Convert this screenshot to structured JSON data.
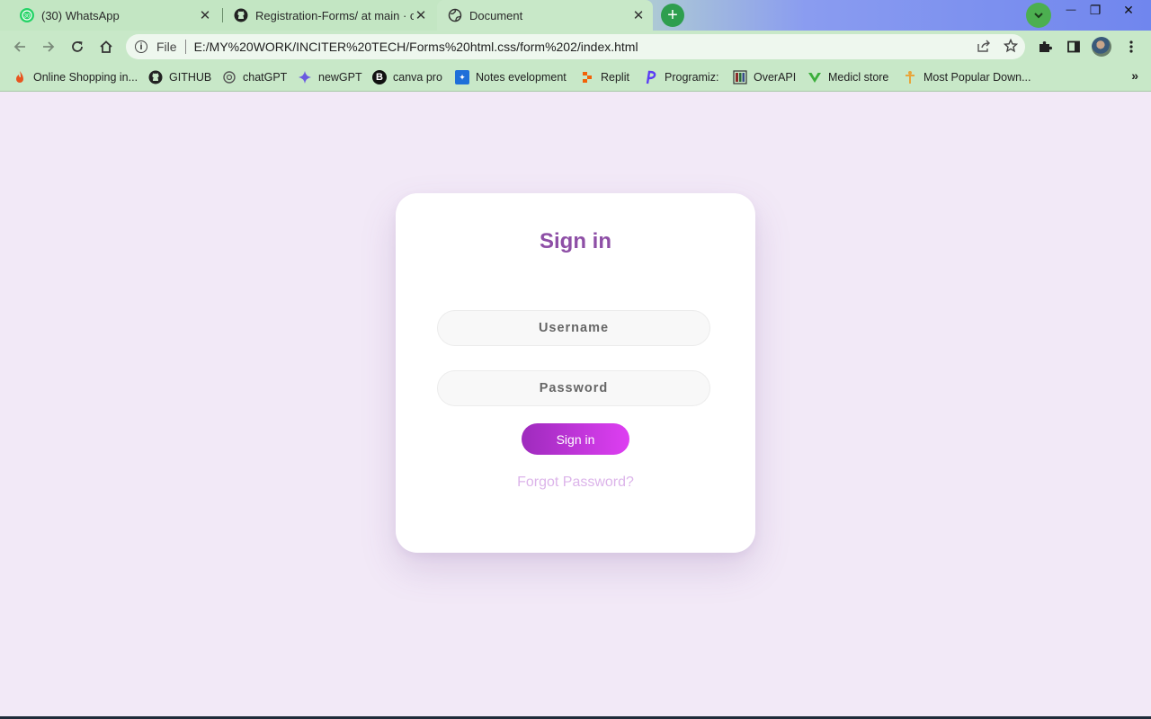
{
  "tabs": [
    {
      "title": "(30) WhatsApp",
      "icon": "whatsapp-icon",
      "badge": "30",
      "active": false
    },
    {
      "title": "Registration-Forms/ at main · code",
      "icon": "github-icon",
      "active": false
    },
    {
      "title": "Document",
      "icon": "globe-icon",
      "active": true
    }
  ],
  "window_controls": {
    "minimize": "—",
    "restore": "❐",
    "close": "✕"
  },
  "address_bar": {
    "scheme": "File",
    "url": "E:/MY%20WORK/INCITER%20TECH/Forms%20html.css/form%202/index.html"
  },
  "bookmarks": [
    {
      "label": "Online Shopping in...",
      "icon": "flame-icon",
      "color": "#e8541e"
    },
    {
      "label": "GITHUB",
      "icon": "github-icon",
      "color": "#222222"
    },
    {
      "label": "chatGPT",
      "icon": "chatgpt-icon",
      "color": "#555555"
    },
    {
      "label": "newGPT",
      "icon": "sparkle-icon",
      "color": "#6a5ae0"
    },
    {
      "label": "canva pro",
      "icon": "b-logo-icon",
      "color": "#111111"
    },
    {
      "label": "Notes evelopment",
      "icon": "notes-icon",
      "color": "#1e6fd9"
    },
    {
      "label": "Replit",
      "icon": "replit-icon",
      "color": "#f26207"
    },
    {
      "label": "Programiz:",
      "icon": "programiz-icon",
      "color": "#5b3df5"
    },
    {
      "label": "OverAPI",
      "icon": "overapi-icon",
      "color": "#8b2b2b"
    },
    {
      "label": "Medicl store",
      "icon": "v-logo-icon",
      "color": "#3cae3c"
    },
    {
      "label": "Most Popular Down...",
      "icon": "figure-icon",
      "color": "#e8a53a"
    }
  ],
  "login": {
    "title": "Sign in",
    "username_placeholder": "Username",
    "password_placeholder": "Password",
    "submit_label": "Sign in",
    "forgot_label": "Forgot Password?"
  },
  "colors": {
    "page_bg": "#f2e9f7",
    "title": "#8e4fa6",
    "button_start": "#9e2bbd",
    "button_end": "#de3ff2",
    "forgot": "#dcb4ea",
    "browser_chrome": "#c8e8c8"
  }
}
